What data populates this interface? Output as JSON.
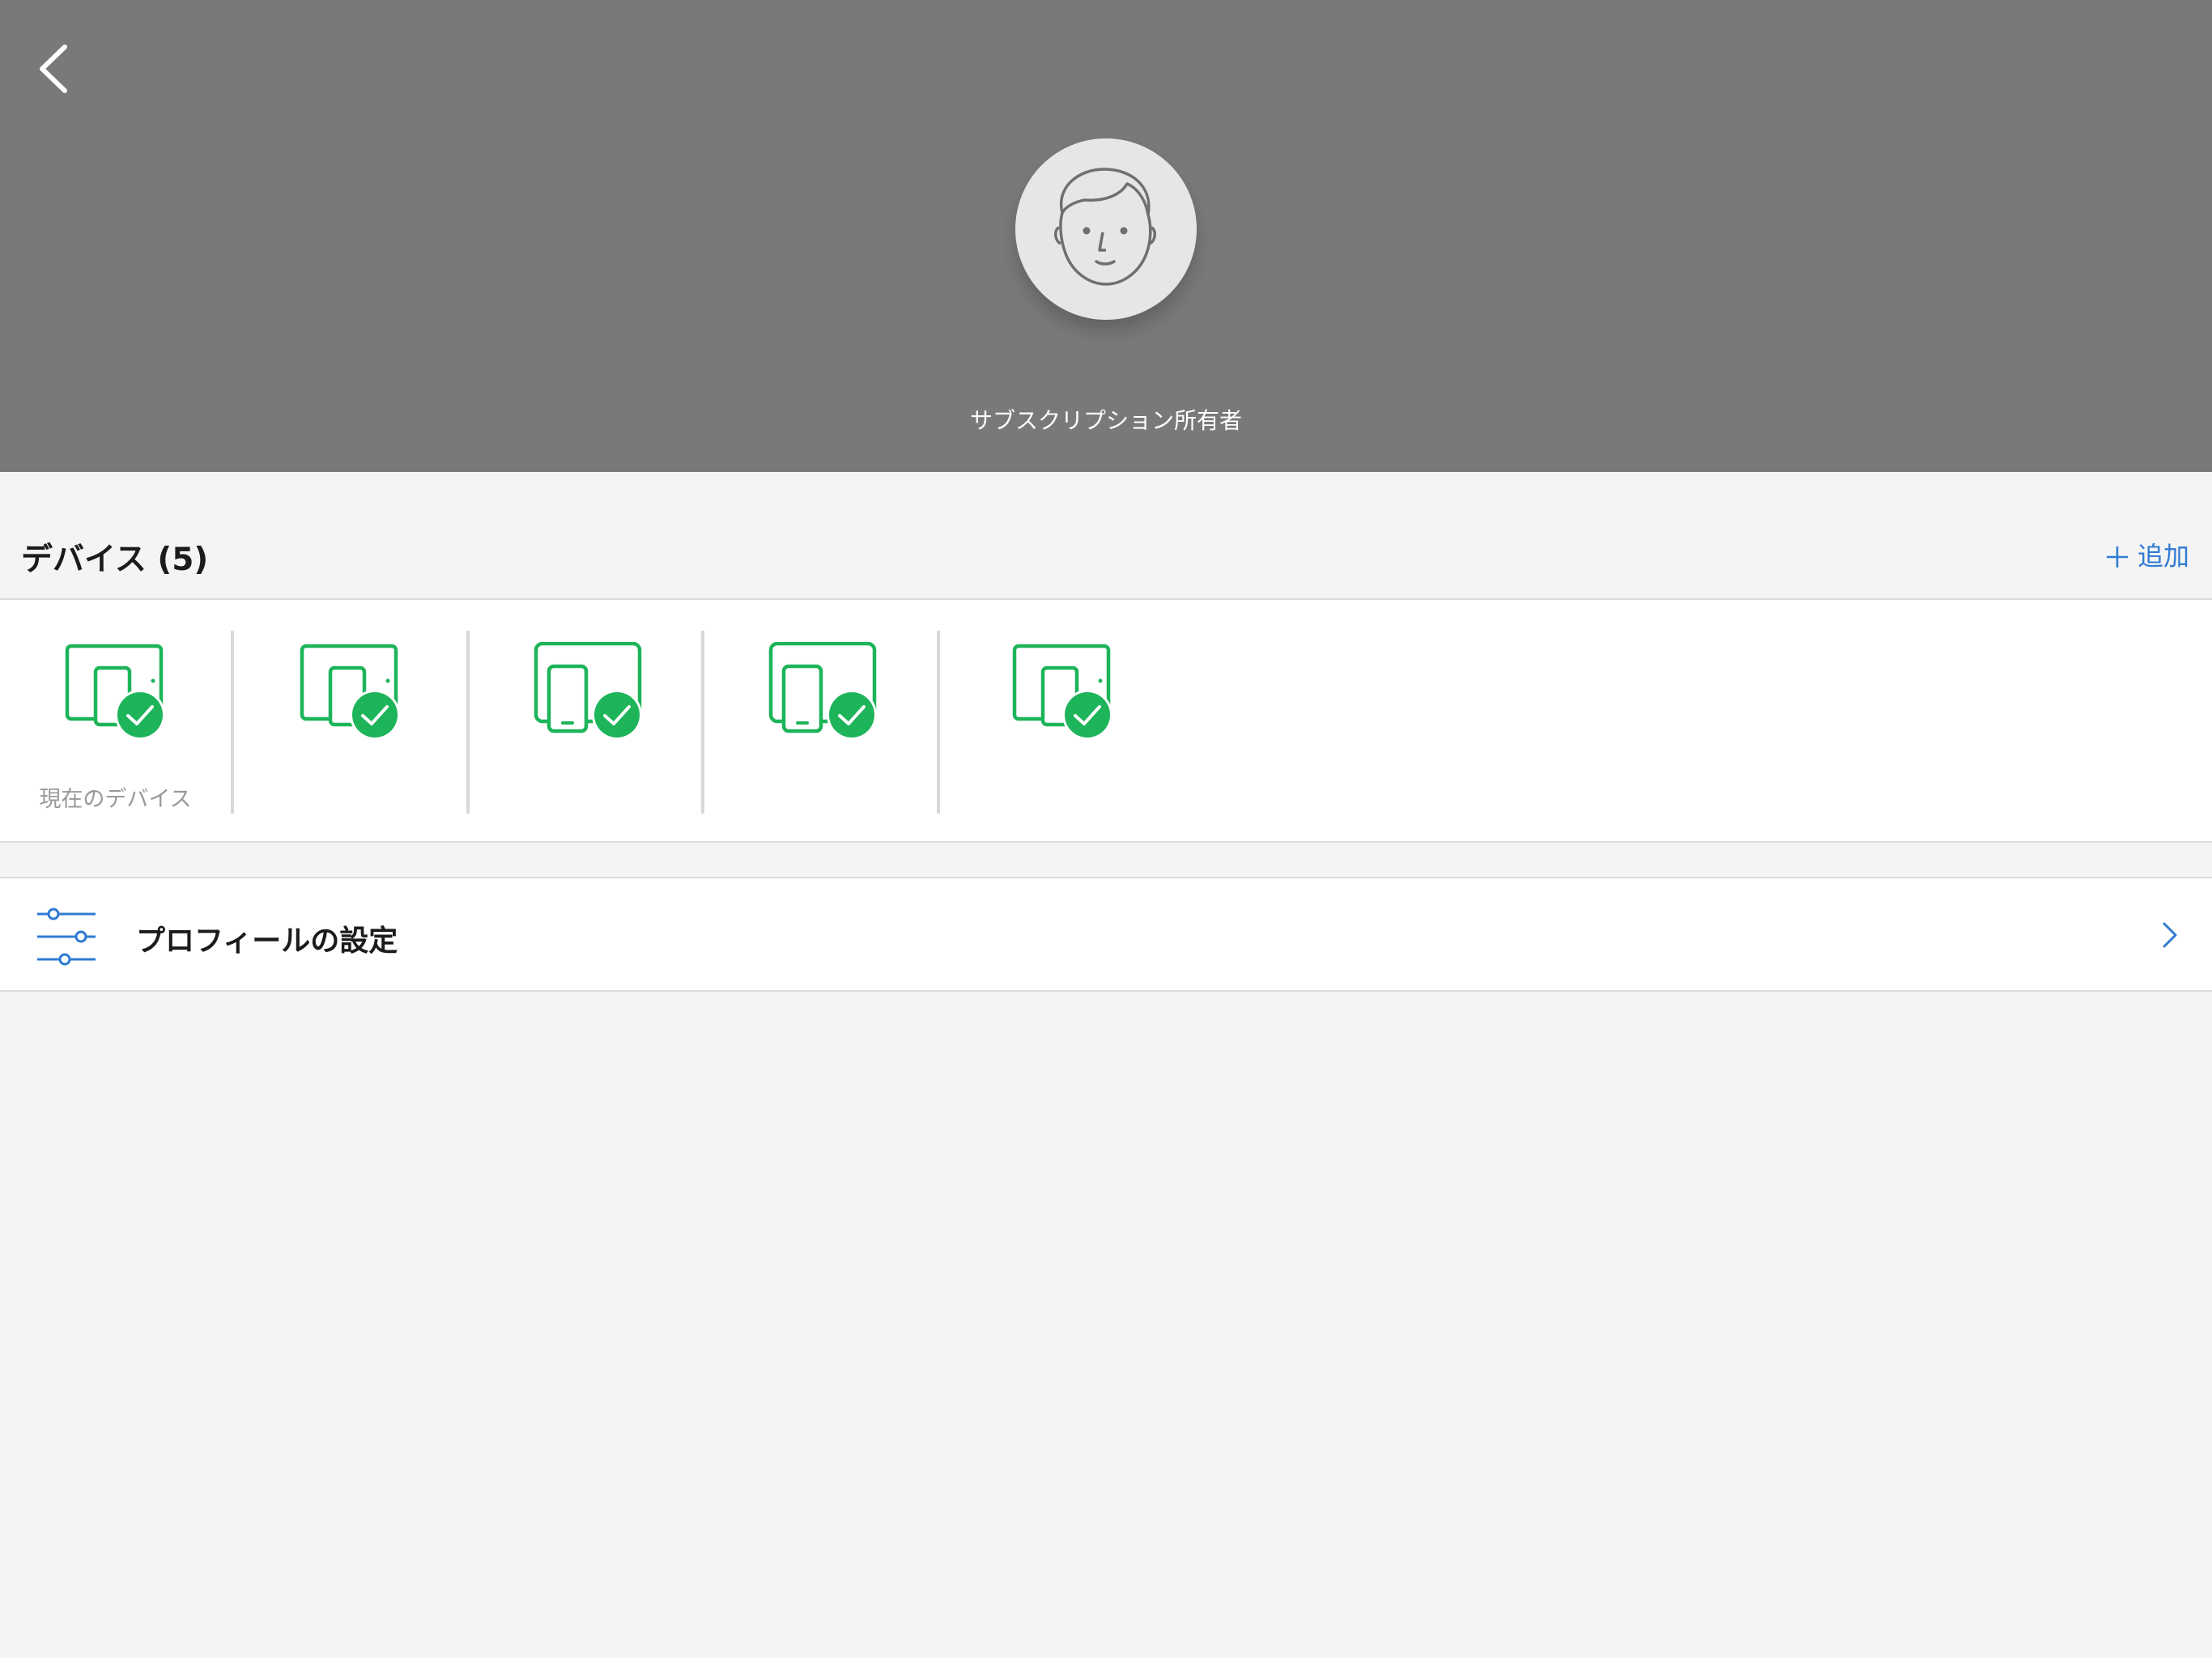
{
  "header": {
    "owner_label": "サブスクリプション所有者"
  },
  "devices": {
    "title": "デバイス (5)",
    "add_label": "追加",
    "items": [
      {
        "icon": "tablet-phone-check-icon",
        "caption": "現在のデバイス"
      },
      {
        "icon": "tablet-phone-check-icon",
        "caption": ""
      },
      {
        "icon": "tablet-phone-check-icon",
        "caption": ""
      },
      {
        "icon": "tablet-phone-check-icon",
        "caption": ""
      },
      {
        "icon": "tablet-phone-check-icon",
        "caption": ""
      }
    ]
  },
  "profile_settings": {
    "label": "プロフィールの設定",
    "icon": "sliders-icon"
  },
  "colors": {
    "header_bg": "#797979",
    "device_green": "#1db45a",
    "link_blue": "#2f7bd2",
    "page_bg": "#f4f4f4"
  }
}
